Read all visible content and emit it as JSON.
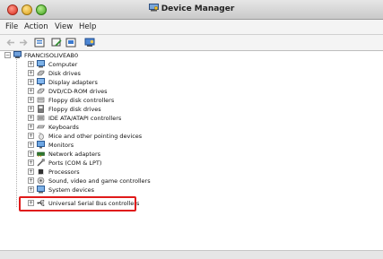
{
  "window": {
    "title": "Device Manager",
    "title_icon": "device-manager-icon"
  },
  "menu": {
    "items": [
      "File",
      "Action",
      "View",
      "Help"
    ]
  },
  "toolbar": {
    "buttons": [
      "back-arrow-icon",
      "forward-arrow-icon",
      "properties-icon",
      "update-driver-icon",
      "help-icon",
      "scan-hardware-icon"
    ]
  },
  "tree": {
    "root": "FRANCISOLIVEAB0",
    "items": [
      {
        "label": "Computer",
        "icon": "computer-icon"
      },
      {
        "label": "Disk drives",
        "icon": "disk-drive-icon"
      },
      {
        "label": "Display adapters",
        "icon": "display-adapter-icon"
      },
      {
        "label": "DVD/CD-ROM drives",
        "icon": "dvd-drive-icon"
      },
      {
        "label": "Floppy disk controllers",
        "icon": "floppy-controller-icon"
      },
      {
        "label": "Floppy disk drives",
        "icon": "floppy-drive-icon"
      },
      {
        "label": "IDE ATA/ATAPI controllers",
        "icon": "ide-controller-icon"
      },
      {
        "label": "Keyboards",
        "icon": "keyboard-icon"
      },
      {
        "label": "Mice and other pointing devices",
        "icon": "mouse-icon"
      },
      {
        "label": "Monitors",
        "icon": "monitor-icon"
      },
      {
        "label": "Network adapters",
        "icon": "network-adapter-icon"
      },
      {
        "label": "Ports (COM & LPT)",
        "icon": "port-icon"
      },
      {
        "label": "Processors",
        "icon": "processor-icon"
      },
      {
        "label": "Sound, video and game controllers",
        "icon": "sound-icon"
      },
      {
        "label": "System devices",
        "icon": "system-device-icon"
      },
      {
        "label": "Universal Serial Bus controllers",
        "icon": "usb-icon",
        "highlighted": true
      }
    ]
  },
  "colors": {
    "highlight": "#e01a1a"
  }
}
